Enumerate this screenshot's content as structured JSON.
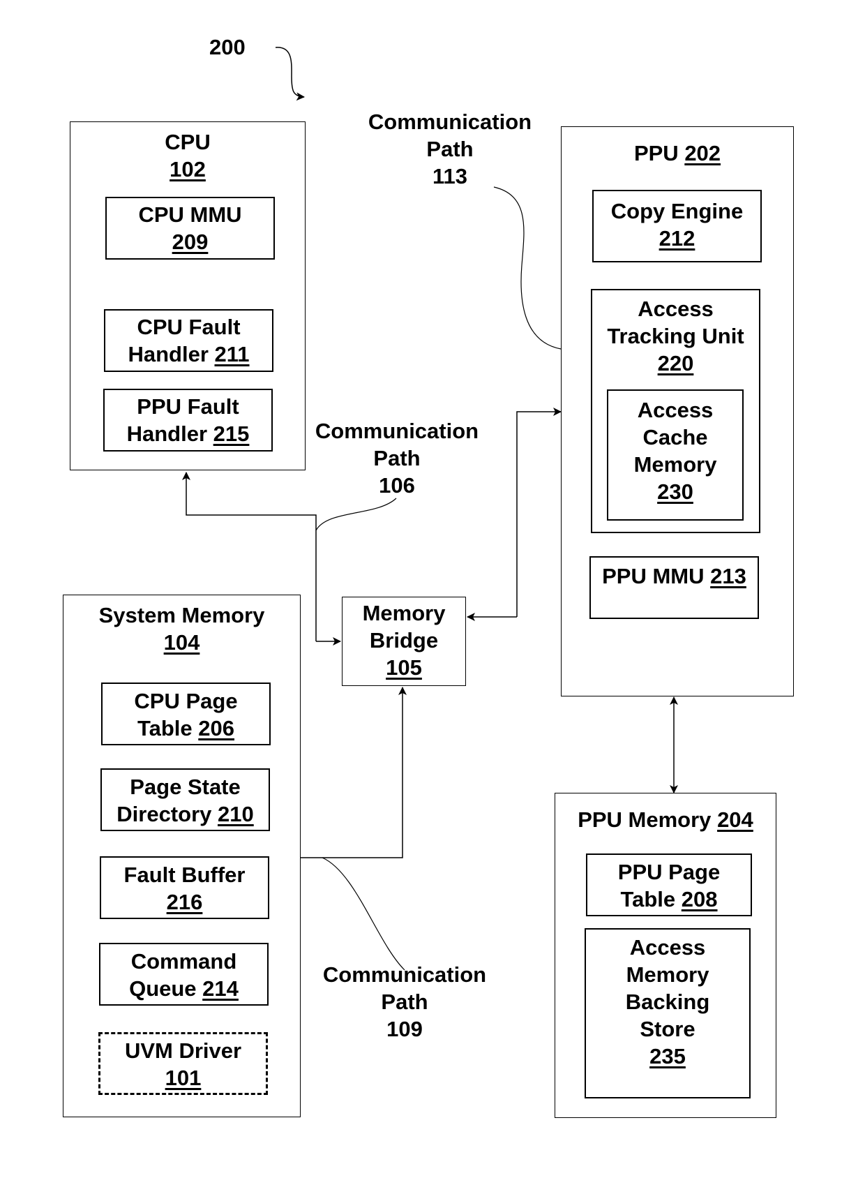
{
  "figure": {
    "reference": "200"
  },
  "blocks": {
    "cpu": {
      "title": "CPU",
      "num": "102"
    },
    "cpu_mmu": {
      "title": "CPU MMU",
      "num": "209"
    },
    "cpu_fault_handler": {
      "line1": "CPU Fault",
      "line2": "Handler",
      "num": "211"
    },
    "ppu_fault_handler": {
      "line1": "PPU Fault",
      "line2": "Handler",
      "num": "215"
    },
    "ppu": {
      "title": "PPU",
      "num": "202"
    },
    "copy_engine": {
      "title": "Copy Engine",
      "num": "212"
    },
    "access_tracking_unit": {
      "line1": "Access",
      "line2": "Tracking Unit",
      "num": "220"
    },
    "access_cache_memory": {
      "line1": "Access",
      "line2": "Cache",
      "line3": "Memory",
      "num": "230"
    },
    "ppu_mmu": {
      "title": "PPU MMU",
      "num": "213"
    },
    "memory_bridge": {
      "line1": "Memory",
      "line2": "Bridge",
      "num": "105"
    },
    "system_memory": {
      "title": "System Memory",
      "num": "104"
    },
    "cpu_page_table": {
      "line1": "CPU Page",
      "line2": "Table",
      "num": "206"
    },
    "page_state_directory": {
      "line1": "Page State",
      "line2": "Directory",
      "num": "210"
    },
    "fault_buffer": {
      "line1": "Fault Buffer",
      "num": "216"
    },
    "command_queue": {
      "line1": "Command",
      "line2": "Queue",
      "num": "214"
    },
    "uvm_driver": {
      "line1": "UVM Driver",
      "num": "101"
    },
    "ppu_memory": {
      "title": "PPU Memory",
      "num": "204"
    },
    "ppu_page_table": {
      "line1": "PPU Page",
      "line2": "Table",
      "num": "208"
    },
    "access_memory_backing_store": {
      "line1": "Access",
      "line2": "Memory",
      "line3": "Backing",
      "line4": "Store",
      "num": "235"
    }
  },
  "paths": {
    "p113": {
      "line1": "Communication",
      "line2": "Path",
      "num": "113"
    },
    "p106": {
      "line1": "Communication",
      "line2": "Path",
      "num": "106"
    },
    "p109": {
      "line1": "Communication",
      "line2": "Path",
      "num": "109"
    }
  }
}
